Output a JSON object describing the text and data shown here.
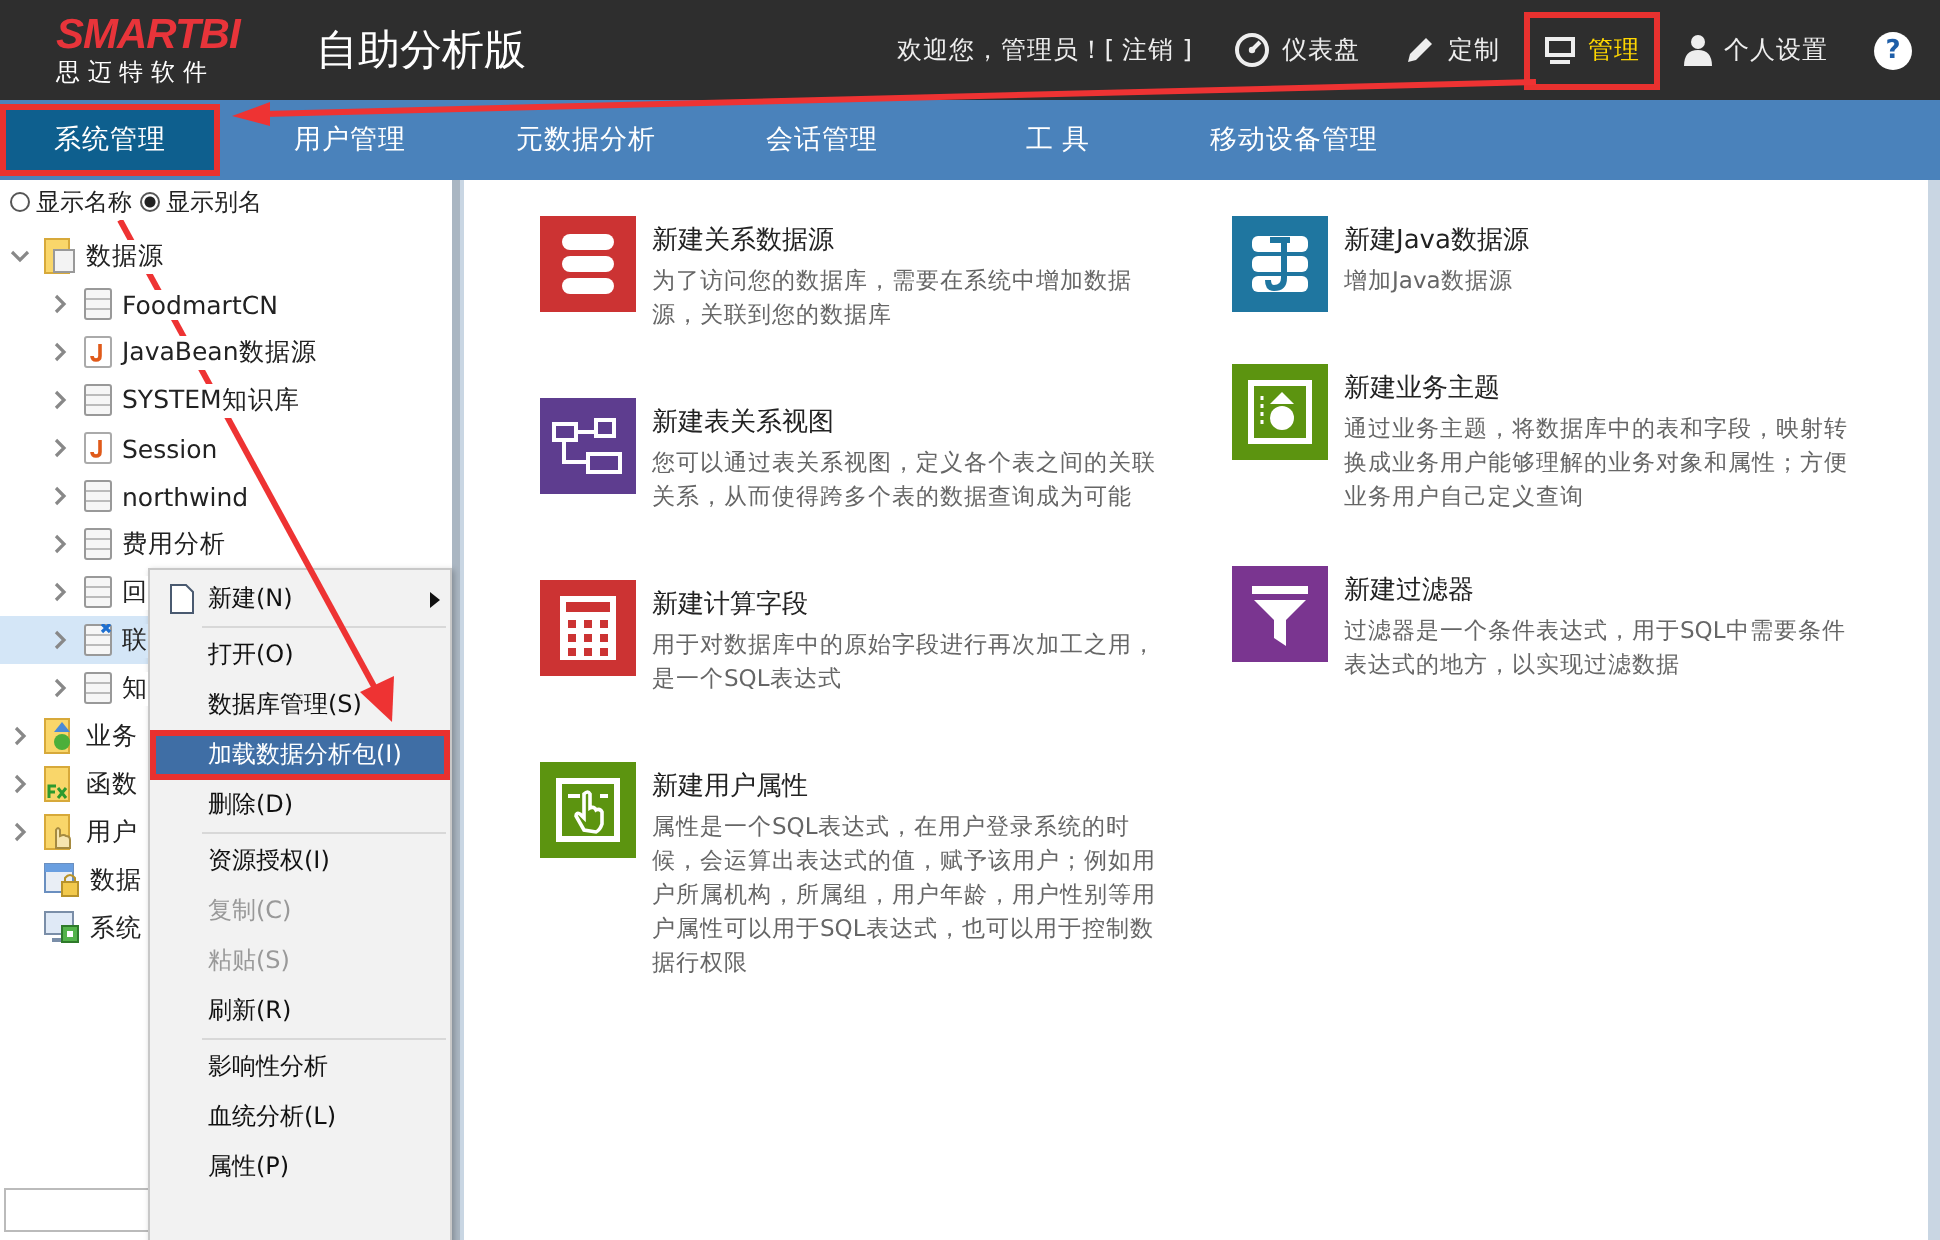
{
  "header": {
    "logo": "SMARTBI",
    "logo_sub": "思 迈 特 软 件",
    "product": "自助分析版",
    "welcome": "欢迎您，管理员！[ 注销 ]",
    "actions": [
      {
        "kind": "gauge",
        "label": "仪表盘",
        "selected": false,
        "highlighted": false
      },
      {
        "kind": "pencil",
        "label": "定制",
        "selected": false,
        "highlighted": false
      },
      {
        "kind": "monitor",
        "label": "管理",
        "selected": true,
        "highlighted": true
      },
      {
        "kind": "user",
        "label": "个人设置",
        "selected": false,
        "highlighted": false
      },
      {
        "kind": "help",
        "label": "?"
      }
    ]
  },
  "tabs": [
    {
      "label": "系统管理",
      "selected": true,
      "highlighted": true
    },
    {
      "label": "用户管理",
      "selected": false,
      "highlighted": false
    },
    {
      "label": "元数据分析",
      "selected": false,
      "highlighted": false
    },
    {
      "label": "会话管理",
      "selected": false,
      "highlighted": false
    },
    {
      "label": "工 具",
      "selected": false,
      "highlighted": false
    },
    {
      "label": "移动设备管理",
      "selected": false,
      "highlighted": false
    }
  ],
  "display_options": [
    {
      "label": "显示名称",
      "selected": false
    },
    {
      "label": "显示别名",
      "selected": true
    }
  ],
  "tree": [
    {
      "label": "数据源",
      "kind": "folder-db",
      "expanded": true,
      "selected": false,
      "children": [
        {
          "label": "FoodmartCN",
          "kind": "db",
          "expanded": false,
          "selected": false
        },
        {
          "label": "JavaBean数据源",
          "kind": "java",
          "expanded": false,
          "selected": false
        },
        {
          "label": "SYSTEM知识库",
          "kind": "db",
          "expanded": false,
          "selected": false
        },
        {
          "label": "Session",
          "kind": "java",
          "expanded": false,
          "selected": false
        },
        {
          "label": "northwind",
          "kind": "db",
          "expanded": false,
          "selected": false
        },
        {
          "label": "费用分析",
          "kind": "db",
          "expanded": false,
          "selected": false
        },
        {
          "label": "回",
          "kind": "db",
          "expanded": false,
          "selected": false
        },
        {
          "label": "联",
          "kind": "db-link",
          "expanded": false,
          "selected": true
        },
        {
          "label": "知",
          "kind": "db",
          "expanded": false,
          "selected": false
        }
      ]
    },
    {
      "label": "业务",
      "kind": "folder-biz",
      "expanded": false,
      "selected": false
    },
    {
      "label": "函数",
      "kind": "folder-fx",
      "expanded": false,
      "selected": false
    },
    {
      "label": "用户",
      "kind": "folder-hand",
      "expanded": false,
      "selected": false
    },
    {
      "label": "数据",
      "kind": "lock",
      "selected": false
    },
    {
      "label": "系统",
      "kind": "monitor",
      "selected": false
    }
  ],
  "context_menu": [
    {
      "kind": "item",
      "label": "新建(N)",
      "icon": true,
      "submenu": true,
      "selected": false,
      "disabled": false,
      "highlighted": false
    },
    {
      "kind": "separator"
    },
    {
      "kind": "item",
      "label": "打开(O)",
      "icon": false,
      "submenu": false,
      "selected": false,
      "disabled": false,
      "highlighted": false
    },
    {
      "kind": "item",
      "label": "数据库管理(S)",
      "icon": false,
      "submenu": false,
      "selected": false,
      "disabled": false,
      "highlighted": false
    },
    {
      "kind": "item",
      "label": "加载数据分析包(I)",
      "icon": false,
      "submenu": false,
      "selected": true,
      "disabled": false,
      "highlighted": true
    },
    {
      "kind": "item",
      "label": "删除(D)",
      "icon": false,
      "submenu": false,
      "selected": false,
      "disabled": false,
      "highlighted": false
    },
    {
      "kind": "separator"
    },
    {
      "kind": "item",
      "label": "资源授权(I)",
      "icon": false,
      "submenu": false,
      "selected": false,
      "disabled": false,
      "highlighted": false
    },
    {
      "kind": "item",
      "label": "复制(C)",
      "icon": false,
      "submenu": false,
      "selected": false,
      "disabled": true,
      "highlighted": false
    },
    {
      "kind": "item",
      "label": "粘贴(S)",
      "icon": false,
      "submenu": false,
      "selected": false,
      "disabled": true,
      "highlighted": false
    },
    {
      "kind": "item",
      "label": "刷新(R)",
      "icon": false,
      "submenu": false,
      "selected": false,
      "disabled": false,
      "highlighted": false
    },
    {
      "kind": "separator"
    },
    {
      "kind": "item",
      "label": "影响性分析",
      "icon": false,
      "submenu": false,
      "selected": false,
      "disabled": false,
      "highlighted": false
    },
    {
      "kind": "item",
      "label": "血统分析(L)",
      "icon": false,
      "submenu": false,
      "selected": false,
      "disabled": false,
      "highlighted": false
    },
    {
      "kind": "item",
      "label": "属性(P)",
      "icon": false,
      "submenu": false,
      "selected": false,
      "disabled": false,
      "highlighted": false
    }
  ],
  "cards_left": [
    {
      "kind": "database",
      "color": "#cc3333",
      "title": "新建关系数据源",
      "desc": "为了访问您的数据库，需要在系统中增加数据源，关联到您的数据库"
    },
    {
      "kind": "view",
      "color": "#5e3d8f",
      "title": "新建表关系视图",
      "desc": "您可以通过表关系视图，定义各个表之间的关联关系，从而使得跨多个表的数据查询成为可能"
    },
    {
      "kind": "calculator",
      "color": "#cc3333",
      "title": "新建计算字段",
      "desc": "用于对数据库中的原始字段进行再次加工之用，是一个SQL表达式"
    },
    {
      "kind": "hand",
      "color": "#5c9410",
      "title": "新建用户属性",
      "desc": "属性是一个SQL表达式，在用户登录系统的时候，会运算出表达式的值，赋予该用户；例如用户所属机构，所属组，用户年龄，用户性别等用户属性可以用于SQL表达式，也可以用于控制数据行权限"
    }
  ],
  "cards_right": [
    {
      "kind": "java",
      "color": "#1f76a0",
      "title": "新建Java数据源",
      "desc": "增加Java数据源"
    },
    {
      "kind": "subject",
      "color": "#5c9410",
      "title": "新建业务主题",
      "desc": "通过业务主题，将数据库中的表和字段，映射转换成业务用户能够理解的业务对象和属性；方便业务用户自己定义查询"
    },
    {
      "kind": "filter",
      "color": "#7a3590",
      "title": "新建过滤器",
      "desc": "过滤器是一个条件表达式，用于SQL中需要条件表达式的地方，以实现过滤数据"
    }
  ]
}
